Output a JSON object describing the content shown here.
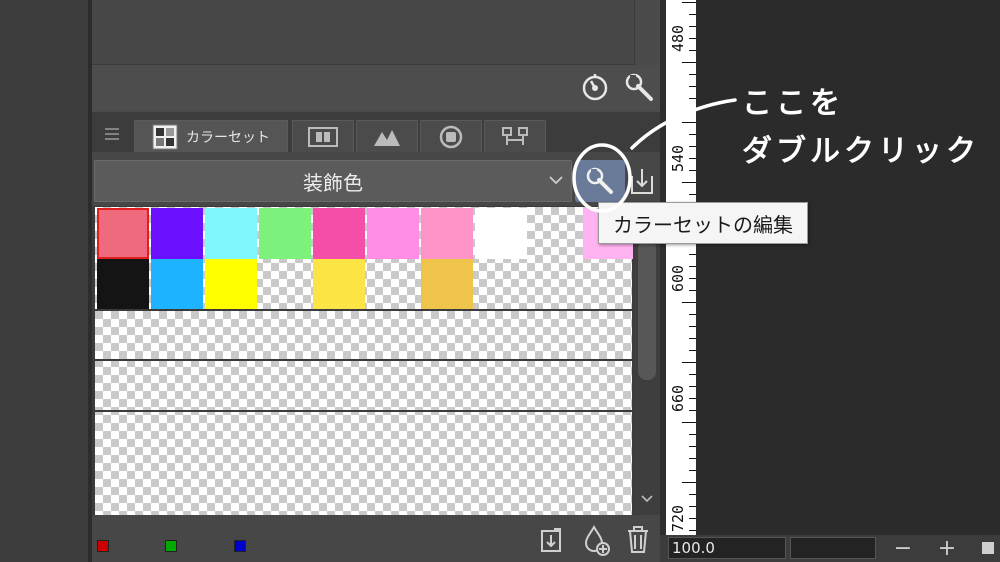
{
  "panel": {
    "tab_colorset_label": "カラーセット",
    "color_set_name": "装飾色"
  },
  "tooltip": {
    "text": "カラーセットの編集"
  },
  "annotation": {
    "line1": "ここを",
    "line2": "ダブルクリック",
    "color": "#ffffff"
  },
  "swatches": {
    "row1": [
      "#f06a7e",
      "#6a10ff",
      "#7ff7ff",
      "#7cf27c",
      "#f54ea8",
      "#ff8de6",
      "#ff94c9",
      "#ffffff",
      "transparent",
      "#ffb3f0"
    ],
    "row2": [
      "#141414",
      "#1eb3ff",
      "#ffff00",
      "transparent",
      "#fce444",
      "transparent",
      "#eec54a",
      "transparent",
      "transparent",
      "transparent"
    ],
    "selected_index": 0
  },
  "mini_swatches": [
    "#cc0000",
    "#00aa00",
    "#0000cc"
  ],
  "ruler": {
    "labels": [
      "480",
      "540",
      "600",
      "660",
      "720"
    ]
  },
  "zoom": {
    "value": "100.0",
    "minus": "−",
    "plus": "+"
  },
  "icons": {
    "list": "hamburger-icon",
    "settings": "timer-icon",
    "tool": "wrench-icon",
    "import": "import-icon",
    "bottom": [
      "import-set-icon",
      "add-color-icon",
      "trash-icon"
    ]
  }
}
